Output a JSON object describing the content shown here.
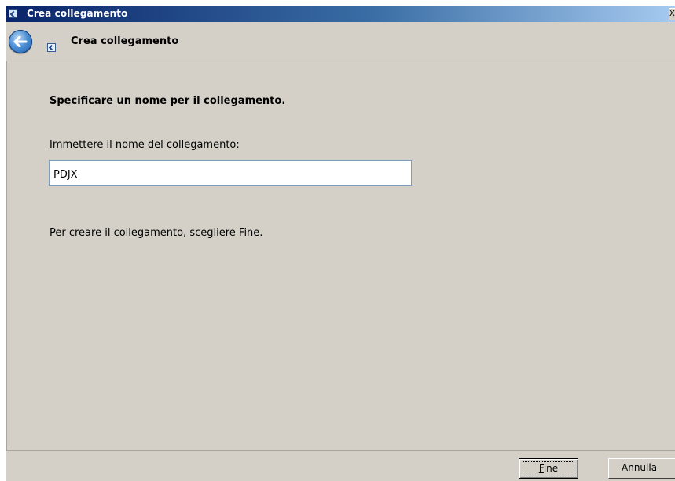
{
  "window": {
    "title": "Crea collegamento",
    "close_glyph": "X"
  },
  "header": {
    "wizard_title": "Crea collegamento",
    "back_icon": "back-arrow-icon"
  },
  "main": {
    "instruction": "Specificare un nome per il collegamento.",
    "field_label_mnemonic": "I",
    "field_label_mnemonic_rest": "m",
    "field_label_rest": "mettere il nome del collegamento:",
    "name_value": "PDJX",
    "finish_hint": "Per creare il collegamento, scegliere Fine."
  },
  "footer": {
    "finish_mnemonic": "F",
    "finish_rest": "ine",
    "cancel_label": "Annulla"
  },
  "colors": {
    "titlebar_start": "#0a246a",
    "titlebar_end": "#a6caf0",
    "face": "#d4d0c8"
  }
}
